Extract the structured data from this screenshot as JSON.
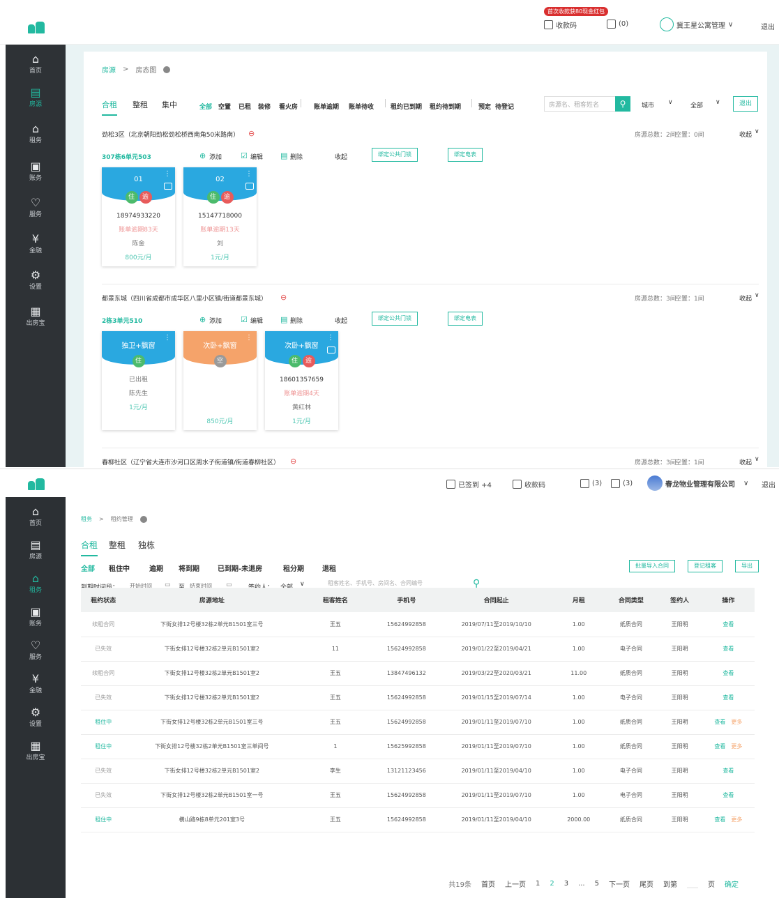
{
  "screen1": {
    "topbar": {
      "promo_tip": "首次收款获80现金红包",
      "qr_label": "收款码",
      "mail_label": "(0)",
      "user_label": "冀王星公寓管理",
      "logout": "退出"
    },
    "sidebar": [
      {
        "label": "首页",
        "glyph": "⌂"
      },
      {
        "label": "房源",
        "glyph": "▤"
      },
      {
        "label": "租务",
        "glyph": "⌂"
      },
      {
        "label": "账务",
        "glyph": "▣"
      },
      {
        "label": "服务",
        "glyph": "♡"
      },
      {
        "label": "金融",
        "glyph": "¥"
      },
      {
        "label": "设置",
        "glyph": "⚙"
      },
      {
        "label": "出房宝",
        "glyph": "▦"
      }
    ],
    "breadcrumb": {
      "root": "房源",
      "sep": ">",
      "current": "房态图"
    },
    "tabs": [
      "合租",
      "整租",
      "集中"
    ],
    "filters": [
      "全部",
      "空置",
      "已租",
      "装修",
      "看火房",
      "账单逾期",
      "账单待收",
      "租约已到期",
      "租约待到期",
      "预定",
      "待登记"
    ],
    "search": {
      "placeholder": "房源名、租客姓名",
      "city": "城市",
      "all": "全部",
      "export": "退出"
    },
    "buildings": [
      {
        "title": "劲松3区（北京朝阳劲松劲松桥西南角50米路南）",
        "stat_total": "房源总数：2间",
        "stat_empty": "空置：0间",
        "collapse": "收起",
        "unit": "307栋6单元503",
        "add": "添加",
        "edit": "编辑",
        "del": "删除",
        "fold": "收起",
        "btn_door": "绑定公共门锁",
        "btn_meter": "绑定电表",
        "rooms": [
          {
            "name": "01",
            "phone": "18974933220",
            "warn": "账单逾期83天",
            "tenant": "陈金",
            "price": "800元/月"
          },
          {
            "name": "02",
            "phone": "15147718000",
            "warn": "账单逾期13天",
            "tenant": "刘",
            "price": "1元/月"
          }
        ]
      },
      {
        "title": "都景东城（四川省成都市成华区八里小区镇/街道都景东城）",
        "stat_total": "房源总数：3间",
        "stat_empty": "空置：1间",
        "collapse": "收起",
        "unit": "2栋3单元510",
        "add": "添加",
        "edit": "编辑",
        "del": "删除",
        "fold": "收起",
        "btn_door": "绑定公共门锁",
        "btn_meter": "绑定电表",
        "rooms": [
          {
            "name": "独卫+飘窗",
            "status": "已出租",
            "tenant": "陈先生",
            "price": "1元/月"
          },
          {
            "name": "次卧+飘窗",
            "price": "850元/月"
          },
          {
            "name": "次卧+飘窗",
            "phone": "18601357659",
            "warn": "账单逾期4天",
            "tenant": "黄红林",
            "price": "1元/月"
          }
        ]
      },
      {
        "title": "春柳社区（辽宁省大连市沙河口区周水子街道镇/街道春柳社区）",
        "stat_total": "房源总数：3间",
        "stat_empty": "空置：1间",
        "collapse": "收起"
      }
    ]
  },
  "screen2": {
    "topbar": {
      "signed": "已签到 +4",
      "qr_label": "收款码",
      "mail_label": "(3)",
      "msg_label": "(3)",
      "company": "春龙物业管理有限公司",
      "logout": "退出"
    },
    "sidebar": [
      {
        "label": "首页",
        "glyph": "⌂"
      },
      {
        "label": "房源",
        "glyph": "▤"
      },
      {
        "label": "租务",
        "glyph": "⌂"
      },
      {
        "label": "账务",
        "glyph": "▣"
      },
      {
        "label": "服务",
        "glyph": "♡"
      },
      {
        "label": "金融",
        "glyph": "¥"
      },
      {
        "label": "设置",
        "glyph": "⚙"
      },
      {
        "label": "出房宝",
        "glyph": "▦"
      }
    ],
    "breadcrumb": {
      "root": "租务",
      "sep": ">",
      "current": "租约管理"
    },
    "tabs": [
      "合租",
      "整租",
      "独栋"
    ],
    "filters": [
      "全部",
      "租住中",
      "逾期",
      "将到期",
      "已到期-未退房",
      "租分期",
      "退租"
    ],
    "actions": {
      "import": "批量导入合同",
      "register": "登记租客",
      "export": "导出"
    },
    "search": {
      "date_label": "到期时间段：",
      "start": "开始时间",
      "to": "至",
      "end": "结束时间",
      "signer_label": "签约人：",
      "signer_value": "全部",
      "placeholder": "租客姓名、手机号、房间名、合同编号"
    },
    "table": {
      "headers": [
        "租约状态",
        "房源地址",
        "租客姓名",
        "手机号",
        "合同起止",
        "月租",
        "合同类型",
        "签约人",
        "操作"
      ],
      "rows": [
        [
          "续租合同",
          "下街女排12号楼32栋2单元B1501室三号",
          "王五",
          "15624992858",
          "2019/07/11至2019/10/10",
          "1.00",
          "纸质合同",
          "王阳明",
          "查看",
          ""
        ],
        [
          "已失效",
          "下街女排12号楼32栋2单元B1501室2",
          "11",
          "15624992858",
          "2019/01/22至2019/04/21",
          "1.00",
          "电子合同",
          "王阳明",
          "查看",
          ""
        ],
        [
          "续租合同",
          "下街女排12号楼32栋2单元B1501室2",
          "王五",
          "13847496132",
          "2019/03/22至2020/03/21",
          "11.00",
          "纸质合同",
          "王阳明",
          "查看",
          ""
        ],
        [
          "已失效",
          "下街女排12号楼32栋2单元B1501室2",
          "王五",
          "15624992858",
          "2019/01/15至2019/07/14",
          "1.00",
          "电子合同",
          "王阳明",
          "查看",
          ""
        ],
        [
          "租住中",
          "下街女排12号楼32栋2单元B1501室三号",
          "王五",
          "15624992858",
          "2019/01/11至2019/07/10",
          "1.00",
          "纸质合同",
          "王阳明",
          "查看",
          "更多"
        ],
        [
          "租住中",
          "下街女排12号楼32栋2单元B1501室三单间号",
          "1",
          "15625992858",
          "2019/01/11至2019/07/10",
          "1.00",
          "纸质合同",
          "王阳明",
          "查看",
          "更多"
        ],
        [
          "已失效",
          "下街女排12号楼32栋2单元B1501室2",
          "李生",
          "13121123456",
          "2019/01/11至2019/04/10",
          "1.00",
          "电子合同",
          "王阳明",
          "查看",
          ""
        ],
        [
          "已失效",
          "下街女排12号楼32栋2单元B1501室一号",
          "王五",
          "15624992858",
          "2019/01/11至2019/07/10",
          "1.00",
          "电子合同",
          "王阳明",
          "查看",
          ""
        ],
        [
          "租住中",
          "横山路9栋8单元201室3号",
          "王五",
          "15624992858",
          "2019/01/11至2019/04/10",
          "2000.00",
          "纸质合同",
          "王阳明",
          "查看",
          "更多"
        ]
      ]
    },
    "pager": {
      "total": "共19条",
      "first": "首页",
      "prev": "上一页",
      "pages": [
        "1",
        "2",
        "3",
        "...",
        "5"
      ],
      "next": "下一页",
      "last": "尾页",
      "goto": "到第",
      "page": "页",
      "confirm": "确定"
    }
  }
}
